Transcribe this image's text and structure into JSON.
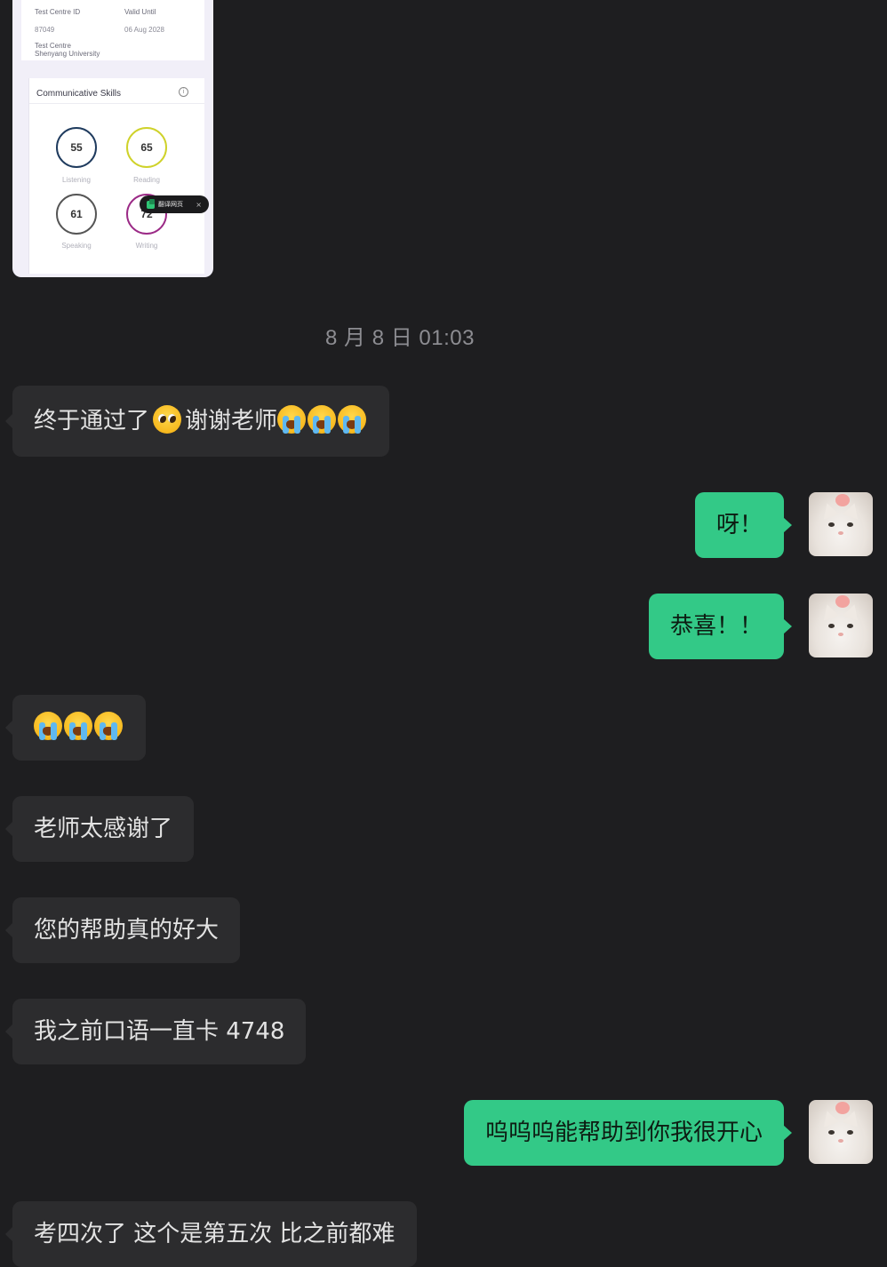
{
  "image_card": {
    "test_centre_id_label": "Test Centre ID",
    "test_centre_id_value": "87049",
    "valid_until_label": "Valid Until",
    "valid_until_value": "06 Aug 2028",
    "test_centre_label": "Test Centre",
    "test_centre_value": "Shenyang University",
    "skills_title": "Communicative Skills",
    "info_glyph": "i",
    "scores": [
      {
        "value": "55",
        "label": "Listening",
        "color": "#1f3b5e"
      },
      {
        "value": "65",
        "label": "Reading",
        "color": "#cfd22a"
      },
      {
        "value": "61",
        "label": "Speaking",
        "color": "#555555"
      },
      {
        "value": "72",
        "label": "Writing",
        "color": "#9b2a86"
      }
    ],
    "translate_popup": {
      "label": "翻译网页",
      "close": "×"
    }
  },
  "timestamp": "8 月 8 日 01:03",
  "messages": [
    {
      "side": "in",
      "text": "终于通过了",
      "text_after": "谢谢老师"
    },
    {
      "side": "out",
      "text": "呀！"
    },
    {
      "side": "out",
      "text": "恭喜！！"
    },
    {
      "side": "in",
      "text": ""
    },
    {
      "side": "in",
      "text": "老师太感谢了"
    },
    {
      "side": "in",
      "text": "您的帮助真的好大"
    },
    {
      "side": "in",
      "text": "我之前口语一直卡 4748"
    },
    {
      "side": "out",
      "text": "呜呜呜能帮助到你我很开心"
    },
    {
      "side": "in",
      "text": "考四次了 这个是第五次 比之前都难"
    }
  ],
  "icons": {
    "crying_emoji": "loudly-crying-face-icon",
    "pleading_emoji": "pleading-face-icon",
    "avatar": "white-cat-avatar"
  }
}
